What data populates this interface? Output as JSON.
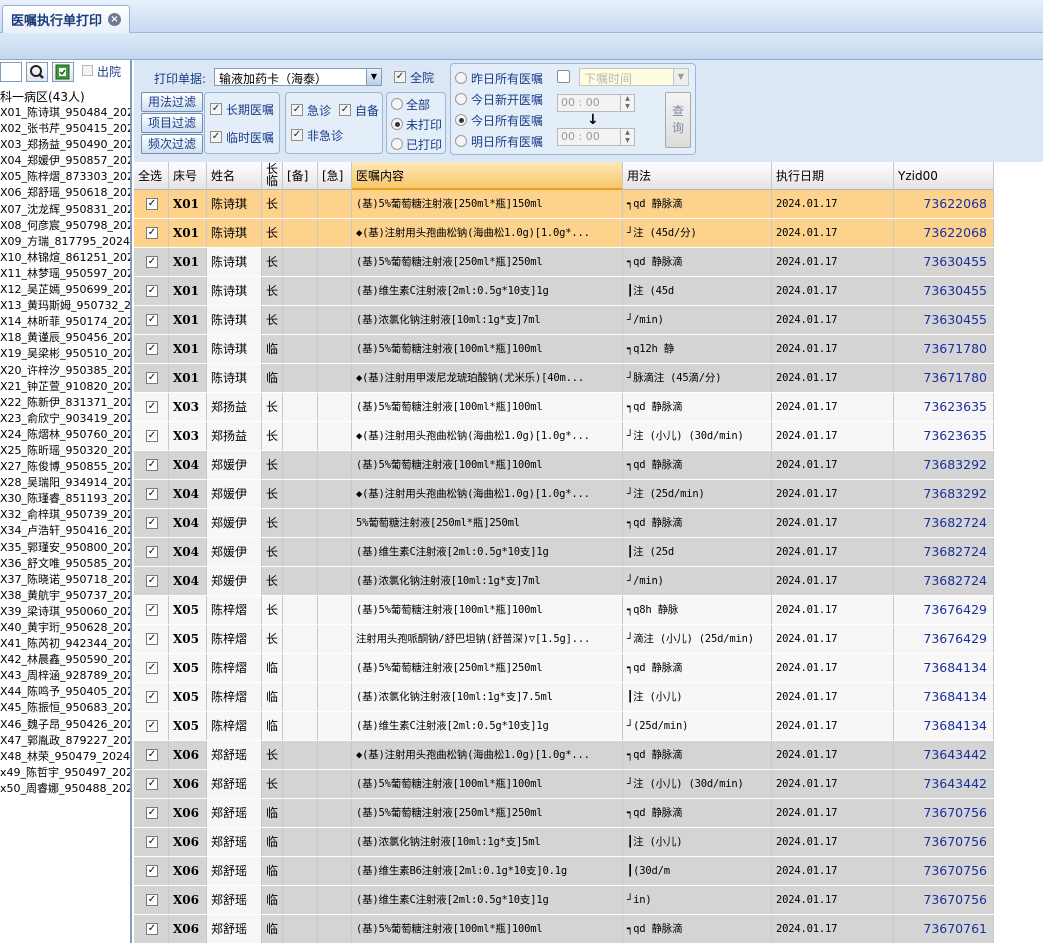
{
  "tab": {
    "title": "医嘱执行单打印",
    "close": "×"
  },
  "left": {
    "out_label": "出院",
    "ward": "科一病区(43人)",
    "patients": [
      "X01_陈诗琪_950484_2024",
      "X02_张书芹_950415_2024",
      "X03_郑扬益_950490_2024",
      "X04_郑媛伊_950857_2024",
      "X05_陈梓熠_873303_2024",
      "X06_郑舒瑶_950618_2024",
      "X07_沈龙辉_950831_2024",
      "X08_何彦宸_950798_2024",
      "X09_方瑞_817795_202401",
      "X10_林锦煊_861251_2024",
      "X11_林梦瑶_950597_2024",
      "X12_吴芷嫣_950699_2024",
      "X13_黄玛斯姆_950732_20",
      "X14_林昕菲_950174_2024",
      "X18_黄谨辰_950456_2024",
      "X19_吴梁彬_950510_2024",
      "X20_许梓汐_950385_2024",
      "X21_钟芷萱_910820_2024",
      "X22_陈新伊_831371_2024",
      "X23_俞欣宁_903419_2024",
      "X24_陈熠林_950760_2024",
      "X25_陈昕瑶_950320_2024",
      "X27_陈俊博_950855_2024",
      "X28_吴瑞阳_934914_2024",
      "X30_陈瑾睿_851193_2024",
      "X32_俞梓琪_950739_2024",
      "X34_卢浩轩_950416_2024",
      "X35_郭瑾安_950800_2024",
      "X36_舒文唯_950585_2024",
      "X37_陈晓诺_950718_2024",
      "X38_黄航宇_950737_2024",
      "X39_梁诗琪_950060_2024",
      "X40_黄宇珩_950628_2024",
      "X41_陈芮初_942344_2024",
      "X42_林晨鑫_950590_2024",
      "X43_周梓涵_928789_2024",
      "X44_陈鸣予_950405_2024",
      "X45_陈振恒_950683_2024",
      "X46_魏子昂_950426_2024",
      "X47_郭胤政_879227_2024",
      "X48_林荣_950479_202401",
      "x49_陈哲宇_950497_2024",
      "x50_周睿娜_950488_2024"
    ]
  },
  "filters": {
    "print_form_label": "打印单据:",
    "print_form_value": "输液加药卡（海泰）",
    "all_hospital": "全院",
    "btn_usage": "用法过滤",
    "btn_item": "项目过滤",
    "btn_freq": "频次过滤",
    "long_term": "长期医嘱",
    "temporary": "临时医嘱",
    "urgent": "急诊",
    "self_prep": "自备",
    "non_urgent": "非急诊",
    "all": "全部",
    "unprinted": "未打印",
    "printed": "已打印",
    "yesterday": "昨日所有医嘱",
    "today_new": "今日新开医嘱",
    "today_all": "今日所有医嘱",
    "tomorrow": "明日所有医嘱",
    "order_time_placeholder": "下嘱时间",
    "time1": "00 : 00",
    "time2": "00 : 00",
    "arrow": "↓",
    "query": "查\n询"
  },
  "grid": {
    "headers": {
      "select_all": "全选",
      "bed": "床号",
      "name": "姓名",
      "type": "长\n临",
      "backup": "[备]",
      "urgent": "[急]",
      "content": "医嘱内容",
      "usage": "用法",
      "date": "执行日期",
      "yzid": "Yzid00"
    },
    "rows": [
      {
        "bed": "X01",
        "name": "陈诗琪",
        "type": "长",
        "content": "(基)5%葡萄糖注射液[250ml*瓶]150ml",
        "usage": "┑qd 静脉滴",
        "date": "2024.01.17",
        "yzid": "73622068",
        "style": "sel"
      },
      {
        "bed": "X01",
        "name": "陈诗琪",
        "type": "长",
        "content": "◆(基)注射用头孢曲松钠(海曲松1.0g)[1.0g*...",
        "usage": "┘注 (45d/分)",
        "date": "2024.01.17",
        "yzid": "73622068",
        "style": "sel"
      },
      {
        "bed": "X01",
        "name": "陈诗琪",
        "type": "长",
        "content": "(基)5%葡萄糖注射液[250ml*瓶]250ml",
        "usage": "┑qd 静脉滴",
        "date": "2024.01.17",
        "yzid": "73630455",
        "style": "gray"
      },
      {
        "bed": "X01",
        "name": "陈诗琪",
        "type": "长",
        "content": "(基)维生素C注射液[2ml:0.5g*10支]1g",
        "usage": "┃注 (45d",
        "date": "2024.01.17",
        "yzid": "73630455",
        "style": "gray"
      },
      {
        "bed": "X01",
        "name": "陈诗琪",
        "type": "长",
        "content": "(基)浓氯化钠注射液[10ml:1g*支]7ml",
        "usage": "┘/min)",
        "date": "2024.01.17",
        "yzid": "73630455",
        "style": "gray"
      },
      {
        "bed": "X01",
        "name": "陈诗琪",
        "type": "临",
        "content": "(基)5%葡萄糖注射液[100ml*瓶]100ml",
        "usage": "┑q12h 静",
        "date": "2024.01.17",
        "yzid": "73671780",
        "style": "gray"
      },
      {
        "bed": "X01",
        "name": "陈诗琪",
        "type": "临",
        "content": "◆(基)注射用甲泼尼龙琥珀酸钠(尤米乐)[40m...",
        "usage": "┘脉滴注 (45滴/分)",
        "date": "2024.01.17",
        "yzid": "73671780",
        "style": "gray"
      },
      {
        "bed": "X03",
        "name": "郑扬益",
        "type": "长",
        "content": "(基)5%葡萄糖注射液[100ml*瓶]100ml",
        "usage": "┑qd 静脉滴",
        "date": "2024.01.17",
        "yzid": "73623635",
        "style": "white"
      },
      {
        "bed": "X03",
        "name": "郑扬益",
        "type": "长",
        "content": "◆(基)注射用头孢曲松钠(海曲松1.0g)[1.0g*...",
        "usage": "┘注 (小儿) (30d/min)",
        "date": "2024.01.17",
        "yzid": "73623635",
        "style": "white"
      },
      {
        "bed": "X04",
        "name": "郑媛伊",
        "type": "长",
        "content": "(基)5%葡萄糖注射液[100ml*瓶]100ml",
        "usage": "┑qd 静脉滴",
        "date": "2024.01.17",
        "yzid": "73683292",
        "style": "gray"
      },
      {
        "bed": "X04",
        "name": "郑媛伊",
        "type": "长",
        "content": "◆(基)注射用头孢曲松钠(海曲松1.0g)[1.0g*...",
        "usage": "┘注 (25d/min)",
        "date": "2024.01.17",
        "yzid": "73683292",
        "style": "gray"
      },
      {
        "bed": "X04",
        "name": "郑媛伊",
        "type": "长",
        "content": "5%葡萄糖注射液[250ml*瓶]250ml",
        "usage": "┑qd 静脉滴",
        "date": "2024.01.17",
        "yzid": "73682724",
        "style": "gray"
      },
      {
        "bed": "X04",
        "name": "郑媛伊",
        "type": "长",
        "content": "(基)维生素C注射液[2ml:0.5g*10支]1g",
        "usage": "┃注 (25d",
        "date": "2024.01.17",
        "yzid": "73682724",
        "style": "gray"
      },
      {
        "bed": "X04",
        "name": "郑媛伊",
        "type": "长",
        "content": "(基)浓氯化钠注射液[10ml:1g*支]7ml",
        "usage": "┘/min)",
        "date": "2024.01.17",
        "yzid": "73682724",
        "style": "gray"
      },
      {
        "bed": "X05",
        "name": "陈梓熠",
        "type": "长",
        "content": "(基)5%葡萄糖注射液[100ml*瓶]100ml",
        "usage": "┑q8h 静脉",
        "date": "2024.01.17",
        "yzid": "73676429",
        "style": "white"
      },
      {
        "bed": "X05",
        "name": "陈梓熠",
        "type": "长",
        "content": "注射用头孢哌酮钠/舒巴坦钠(舒普深)▽[1.5g]...",
        "usage": "┘滴注 (小儿) (25d/min)",
        "date": "2024.01.17",
        "yzid": "73676429",
        "style": "white"
      },
      {
        "bed": "X05",
        "name": "陈梓熠",
        "type": "临",
        "content": "(基)5%葡萄糖注射液[250ml*瓶]250ml",
        "usage": "┑qd 静脉滴",
        "date": "2024.01.17",
        "yzid": "73684134",
        "style": "white"
      },
      {
        "bed": "X05",
        "name": "陈梓熠",
        "type": "临",
        "content": "(基)浓氯化钠注射液[10ml:1g*支]7.5ml",
        "usage": "┃注 (小儿)",
        "date": "2024.01.17",
        "yzid": "73684134",
        "style": "white"
      },
      {
        "bed": "X05",
        "name": "陈梓熠",
        "type": "临",
        "content": "(基)维生素C注射液[2ml:0.5g*10支]1g",
        "usage": "┘(25d/min)",
        "date": "2024.01.17",
        "yzid": "73684134",
        "style": "white"
      },
      {
        "bed": "X06",
        "name": "郑舒瑶",
        "type": "长",
        "content": "◆(基)注射用头孢曲松钠(海曲松1.0g)[1.0g*...",
        "usage": "┑qd 静脉滴",
        "date": "2024.01.17",
        "yzid": "73643442",
        "style": "gray"
      },
      {
        "bed": "X06",
        "name": "郑舒瑶",
        "type": "长",
        "content": "(基)5%葡萄糖注射液[100ml*瓶]100ml",
        "usage": "┘注 (小儿) (30d/min)",
        "date": "2024.01.17",
        "yzid": "73643442",
        "style": "gray"
      },
      {
        "bed": "X06",
        "name": "郑舒瑶",
        "type": "临",
        "content": "(基)5%葡萄糖注射液[250ml*瓶]250ml",
        "usage": "┑qd 静脉滴",
        "date": "2024.01.17",
        "yzid": "73670756",
        "style": "gray"
      },
      {
        "bed": "X06",
        "name": "郑舒瑶",
        "type": "临",
        "content": "(基)浓氯化钠注射液[10ml:1g*支]5ml",
        "usage": "┃注 (小儿)",
        "date": "2024.01.17",
        "yzid": "73670756",
        "style": "gray"
      },
      {
        "bed": "X06",
        "name": "郑舒瑶",
        "type": "临",
        "content": "(基)维生素B6注射液[2ml:0.1g*10支]0.1g",
        "usage": "┃(30d/m",
        "date": "2024.01.17",
        "yzid": "73670756",
        "style": "gray"
      },
      {
        "bed": "X06",
        "name": "郑舒瑶",
        "type": "临",
        "content": "(基)维生素C注射液[2ml:0.5g*10支]1g",
        "usage": "┘in)",
        "date": "2024.01.17",
        "yzid": "73670756",
        "style": "gray"
      },
      {
        "bed": "X06",
        "name": "郑舒瑶",
        "type": "临",
        "content": "(基)5%葡萄糖注射液[100ml*瓶]100ml",
        "usage": "┑qd 静脉滴",
        "date": "2024.01.17",
        "yzid": "73670761",
        "style": "gray"
      }
    ]
  }
}
